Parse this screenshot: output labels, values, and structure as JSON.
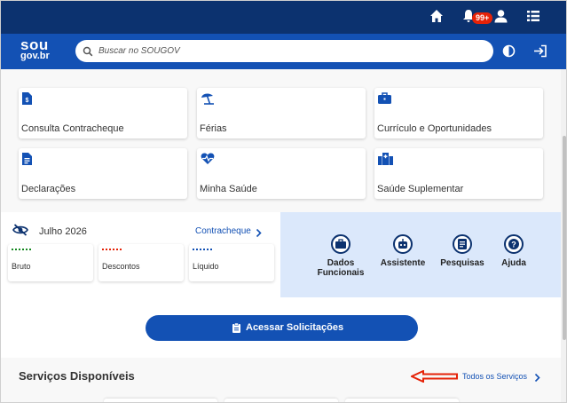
{
  "topbar": {
    "notification_count": "99+",
    "icons": [
      "home-icon",
      "bell-icon",
      "user-icon",
      "list-icon"
    ]
  },
  "header": {
    "logo_line1": "sou",
    "logo_line2": "gov.br",
    "search_placeholder": "Buscar no SOUGOV"
  },
  "cards": [
    {
      "label": "Consulta Contracheque",
      "icon": "payslip-icon"
    },
    {
      "label": "Férias",
      "icon": "beach-umbrella-icon"
    },
    {
      "label": "Currículo e Oportunidades",
      "icon": "briefcase-icon"
    },
    {
      "label": "Declarações",
      "icon": "document-icon"
    },
    {
      "label": "Minha Saúde",
      "icon": "heart-pulse-icon"
    },
    {
      "label": "Saúde Suplementar",
      "icon": "hospital-icon"
    }
  ],
  "salary": {
    "month": "Julho 2026",
    "link": "Contracheque",
    "items": [
      {
        "label": "Bruto",
        "color": "#168821"
      },
      {
        "label": "Descontos",
        "color": "#e52207"
      },
      {
        "label": "Líquido",
        "color": "#1351b4"
      }
    ]
  },
  "quick_links": [
    {
      "label_line1": "Dados",
      "label_line2": "Funcionais",
      "icon": "briefcase-icon"
    },
    {
      "label_line1": "Assistente",
      "label_line2": "",
      "icon": "robot-icon"
    },
    {
      "label_line1": "Pesquisas",
      "label_line2": "",
      "icon": "survey-icon"
    },
    {
      "label_line1": "Ajuda",
      "label_line2": "",
      "icon": "help-icon"
    }
  ],
  "actions": {
    "solicitacoes": "Acessar Solicitações"
  },
  "servicos": {
    "title": "Serviços Disponíveis",
    "link": "Todos os Serviços"
  },
  "colors": {
    "topbar": "#0c326f",
    "header": "#1351b4",
    "accent": "#1351b4",
    "annotation_arrow": "#e52207"
  }
}
